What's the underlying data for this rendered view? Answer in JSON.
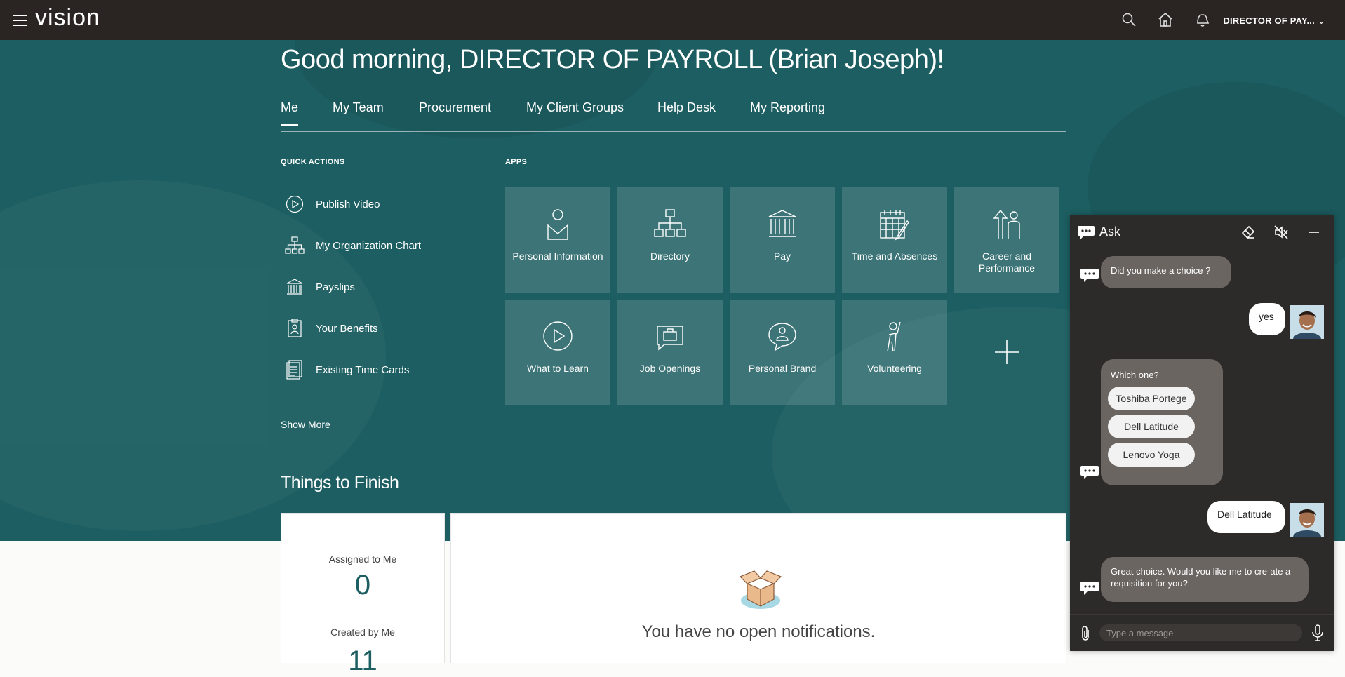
{
  "topbar": {
    "logo": "vision",
    "user_label": "DIRECTOR OF PAY...",
    "icons": [
      "menu-icon",
      "search-icon",
      "home-icon",
      "notifications-icon"
    ]
  },
  "greeting": "Good morning, DIRECTOR OF PAYROLL (Brian Joseph)!",
  "tabs": [
    {
      "label": "Me",
      "active": true
    },
    {
      "label": "My Team"
    },
    {
      "label": "Procurement"
    },
    {
      "label": "My Client Groups"
    },
    {
      "label": "Help Desk"
    },
    {
      "label": "My Reporting"
    }
  ],
  "quick_actions": {
    "title": "QUICK ACTIONS",
    "items": [
      {
        "label": "Publish Video",
        "icon": "play-circle-icon"
      },
      {
        "label": "My Organization Chart",
        "icon": "org-chart-icon"
      },
      {
        "label": "Payslips",
        "icon": "bank-icon"
      },
      {
        "label": "Your Benefits",
        "icon": "benefits-icon"
      },
      {
        "label": "Existing Time Cards",
        "icon": "time-card-icon"
      }
    ],
    "show_more": "Show More"
  },
  "apps": {
    "title": "APPS",
    "tiles": [
      {
        "label": "Personal Information",
        "icon": "person-icon"
      },
      {
        "label": "Directory",
        "icon": "directory-icon"
      },
      {
        "label": "Pay",
        "icon": "bank-icon"
      },
      {
        "label": "Time and Absences",
        "icon": "calendar-icon"
      },
      {
        "label": "Career and Performance",
        "icon": "career-icon"
      },
      {
        "label": "What to Learn",
        "icon": "play-circle-icon"
      },
      {
        "label": "Job Openings",
        "icon": "briefcase-chat-icon"
      },
      {
        "label": "Personal Brand",
        "icon": "brand-chat-icon"
      },
      {
        "label": "Volunteering",
        "icon": "volunteer-icon"
      }
    ],
    "add_icon": "plus-icon"
  },
  "things_to_finish": {
    "title": "Things to Finish",
    "assigned_label": "Assigned to Me",
    "assigned_count": "0",
    "created_label": "Created by Me",
    "created_count": "11",
    "empty_message": "You have no open notifications."
  },
  "chat": {
    "title": "Ask",
    "placeholder": "Type a message",
    "messages": {
      "bot1": "Did you make a choice ?",
      "user1": "yes",
      "bot2": "Which one?",
      "choices": [
        "Toshiba Portege",
        "Dell Latitude",
        "Lenovo Yoga"
      ],
      "user2": "Dell Latitude",
      "bot3": "Great choice.  Would you like me to cre-ate a requisition for you?"
    }
  },
  "colors": {
    "topbar": "#2a2522",
    "hero": "#1c5e61",
    "chat_panel": "#2d2b29",
    "bot_bubble": "#6b6562"
  }
}
